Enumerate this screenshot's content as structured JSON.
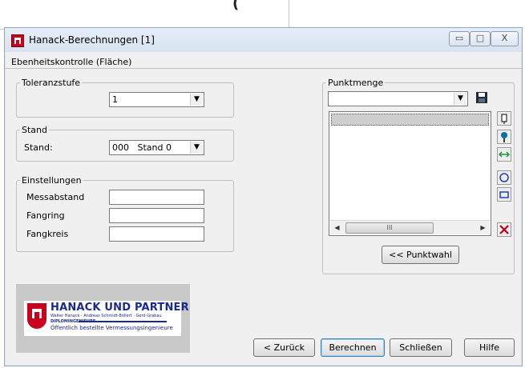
{
  "window": {
    "title": "Hanack-Berechnungen [1]",
    "controls": {
      "minimize": "▭",
      "maximize": "□",
      "close": "X"
    }
  },
  "page_heading": "Ebenheitskontrolle (Fläche)",
  "toleranzstufe": {
    "legend": "Toleranzstufe",
    "value": "1"
  },
  "stand": {
    "legend": "Stand",
    "label": "Stand:",
    "value": "000   Stand 0"
  },
  "einstellungen": {
    "legend": "Einstellungen",
    "fields": [
      {
        "label": "Messabstand",
        "value": ""
      },
      {
        "label": "Fangring",
        "value": ""
      },
      {
        "label": "Fangkreis",
        "value": ""
      }
    ]
  },
  "punktmenge": {
    "legend": "Punktmenge",
    "combo_value": "",
    "scroll_thumb": "III",
    "punktwahl_label": "<< Punktwahl"
  },
  "tools": [
    "save-icon",
    "pin-icon",
    "point-pick-icon",
    "measure-distance-icon",
    "circle-icon",
    "rectangle-icon",
    "delete-icon"
  ],
  "logo": {
    "title": "HANACK UND PARTNER",
    "subtitle": "Walter Hanack · Andreas Schmidt-Böllert · Gerd Grabau",
    "dip": "DIPLOMINGENIEURE",
    "line": "Öffentlich bestellte Vermessungsingenieure"
  },
  "buttons": {
    "back": "< Zurück",
    "calculate": "Berechnen",
    "close": "Schließen",
    "help": "Hilfe"
  },
  "colors": {
    "accent_blue": "#1a2a8c",
    "brand_red": "#c8001e"
  }
}
